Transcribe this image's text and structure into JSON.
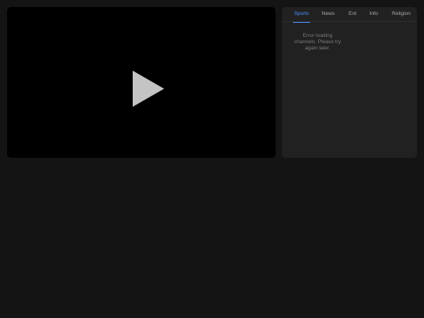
{
  "player": {
    "play_icon": "play-icon"
  },
  "channels": {
    "tabs": [
      {
        "label": "Sports",
        "active": true
      },
      {
        "label": "News",
        "active": false
      },
      {
        "label": "Ent",
        "active": false
      },
      {
        "label": "Info",
        "active": false
      },
      {
        "label": "Religion",
        "active": false
      }
    ],
    "error_message": "Error loading channels. Please try again later."
  },
  "colors": {
    "background": "#141414",
    "player_background": "#000000",
    "panel_background": "#212121",
    "accent": "#4d8eff",
    "play_icon": "#c4c4c4"
  }
}
